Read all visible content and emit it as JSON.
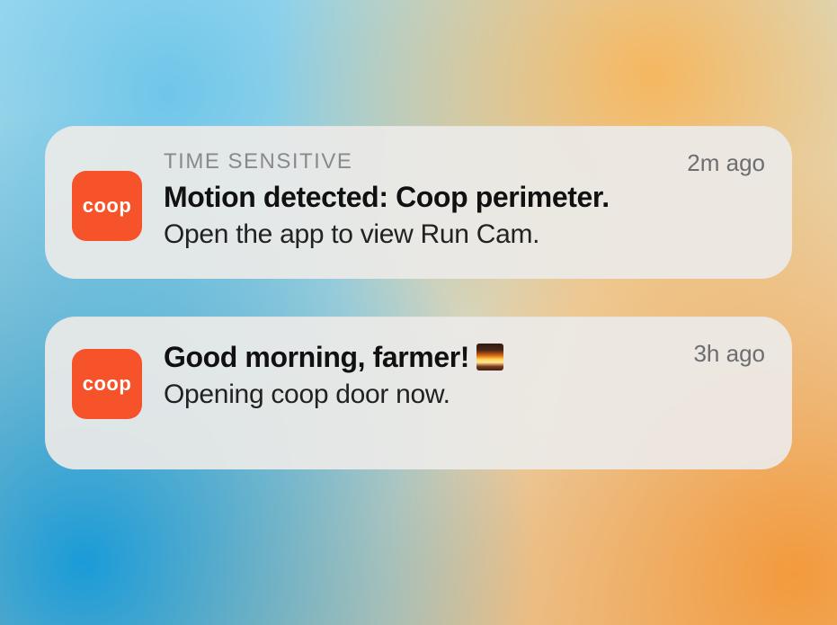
{
  "app": {
    "icon_label": "coop",
    "icon_color": "#f0552e"
  },
  "notifications": [
    {
      "flag": "TIME SENSITIVE",
      "title": "Motion detected: Coop perimeter.",
      "body": "Open the app to view Run Cam.",
      "timestamp": "2m ago",
      "emoji": null
    },
    {
      "flag": null,
      "title": "Good morning, farmer!",
      "body": "Opening coop door now.",
      "timestamp": "3h ago",
      "emoji": "sunrise"
    }
  ]
}
